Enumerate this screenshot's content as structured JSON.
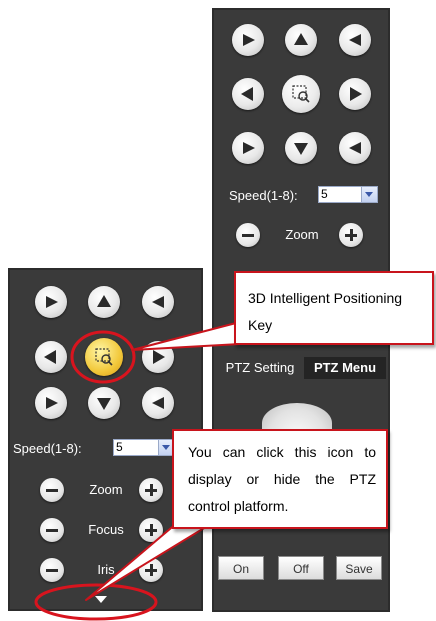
{
  "colors": {
    "panel_bg": "#3a3a3a",
    "callout_border": "#c8141c",
    "active_center": "#f2c83a"
  },
  "icons": {
    "direction_pad": [
      "upleft-arrow-icon",
      "up-arrow-icon",
      "upright-arrow-icon",
      "left-arrow-icon",
      "3d-positioning-icon",
      "right-arrow-icon",
      "downleft-arrow-icon",
      "down-arrow-icon",
      "downright-arrow-icon"
    ],
    "toggle": "caret-down-icon"
  },
  "right_panel": {
    "speed_label": "Speed(1-8):",
    "speed_value": "5",
    "zoom_label": "Zoom",
    "tabs": [
      {
        "label": "PTZ Setting"
      },
      {
        "label": "PTZ Menu"
      }
    ],
    "buttons": {
      "on": "On",
      "off": "Off",
      "save": "Save"
    }
  },
  "left_panel": {
    "speed_label": "Speed(1-8):",
    "speed_value": "5",
    "zoom_label": "Zoom",
    "focus_label": "Focus",
    "iris_label": "Iris"
  },
  "callouts": {
    "positioning": "3D Intelligent Positioning Key",
    "toggle": "You can click this icon to display or hide the PTZ control platform."
  }
}
